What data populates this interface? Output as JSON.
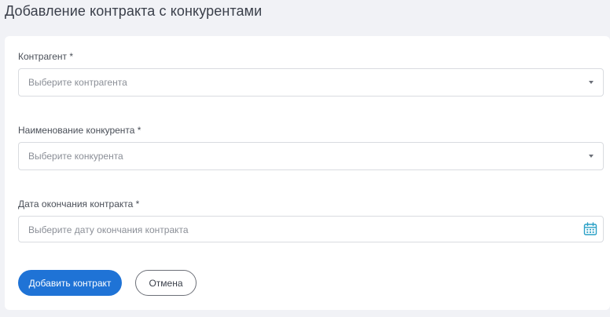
{
  "page": {
    "title": "Добавление контракта с конкурентами"
  },
  "form": {
    "contractor": {
      "label": "Контрагент *",
      "placeholder": "Выберите контрагента"
    },
    "competitor": {
      "label": "Наименование конкурента *",
      "placeholder": "Выберите конкурента"
    },
    "end_date": {
      "label": "Дата окончания контракта *",
      "placeholder": "Выберите дату окончания контракта"
    }
  },
  "actions": {
    "submit_label": "Добавить контракт",
    "cancel_label": "Отмена"
  },
  "icons": {
    "select_caret": "chevron-down-icon",
    "date_picker": "calendar-icon"
  },
  "colors": {
    "primary": "#1f73d6",
    "calendar_icon": "#2aa0c6",
    "background": "#f1f2f6"
  }
}
